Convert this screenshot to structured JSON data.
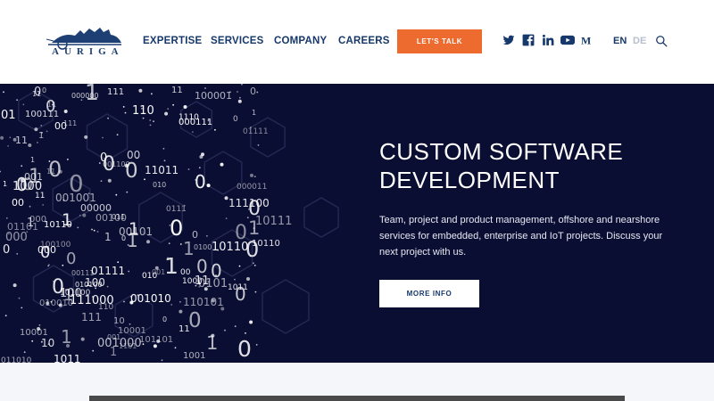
{
  "brand": {
    "name": "AURIGA"
  },
  "nav": {
    "items": [
      {
        "label": "EXPERTISE"
      },
      {
        "label": "SERVICES"
      },
      {
        "label": "COMPANY"
      },
      {
        "label": "CAREERS"
      }
    ],
    "cta_label": "LET'S TALK",
    "social": [
      "twitter-icon",
      "facebook-icon",
      "linkedin-icon",
      "youtube-icon",
      "medium-icon"
    ],
    "languages": [
      {
        "label": "EN",
        "active": true,
        "color": "#16386a"
      },
      {
        "label": "DE",
        "active": false,
        "color": "#b7bfcc"
      }
    ]
  },
  "hero": {
    "title_line1": "CUSTOM SOFTWARE",
    "title_line2": "DEVELOPMENT",
    "description": "Team, project and product management, offshore and nearshore services for embedded, enterprise and IoT projects. Discuss your next project with us.",
    "button_label": "MORE INFO"
  },
  "colors": {
    "accent": "#ee6b30",
    "navy": "#16386a",
    "hero_bg": "#0b0e33"
  }
}
